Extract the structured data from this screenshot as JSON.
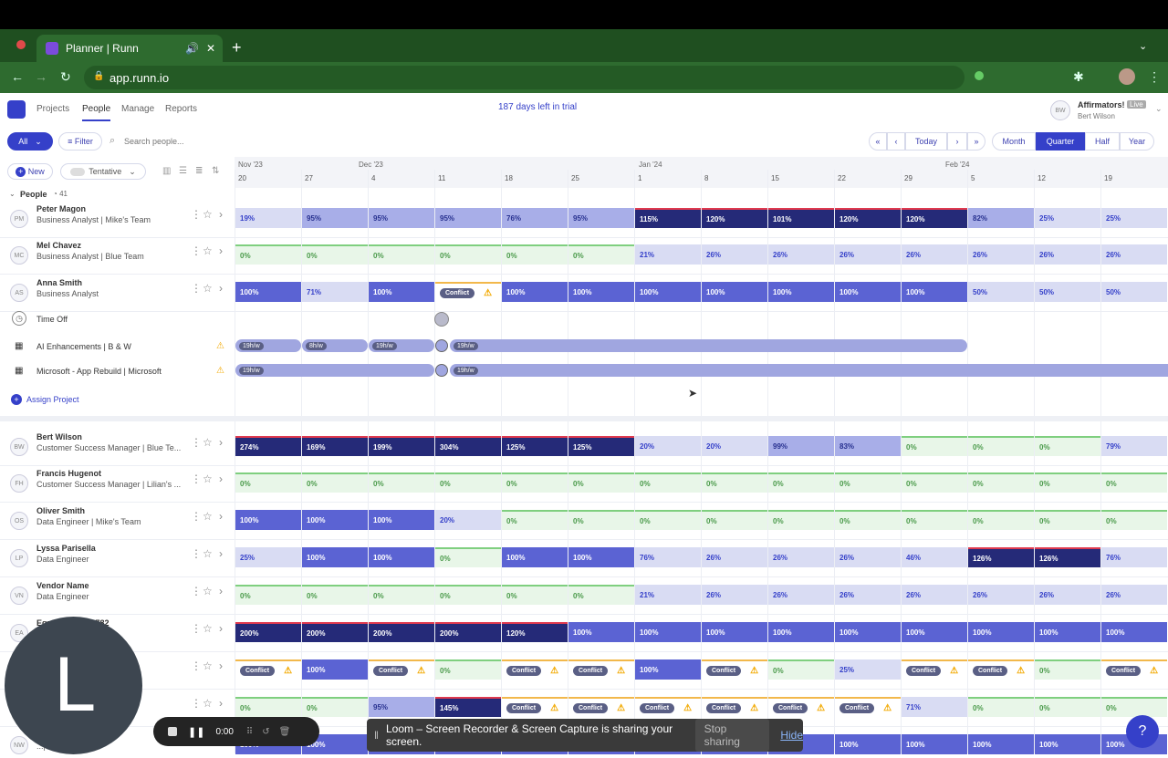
{
  "browser": {
    "tab_title": "Planner | Runn",
    "url": "app.runn.io"
  },
  "nav": {
    "projects": "Projects",
    "people": "People",
    "manage": "Manage",
    "reports": "Reports",
    "trial": "187 days left in trial"
  },
  "account": {
    "initials": "BW",
    "org": "Affirmators!",
    "badge": "Live",
    "user": "Bert Wilson"
  },
  "toolbar": {
    "all": "All",
    "filter": "Filter",
    "search_placeholder": "Search people...",
    "today": "Today",
    "new": "New",
    "tentative": "Tentative",
    "views": [
      "Month",
      "Quarter",
      "Half",
      "Year"
    ],
    "active_view": "Quarter"
  },
  "timeline": {
    "months": [
      {
        "label": "Nov '23"
      },
      {
        "label": "Dec '23"
      },
      {
        "label": "Jan '24"
      },
      {
        "label": "Feb '24"
      }
    ],
    "weeks": [
      "20",
      "27",
      "4",
      "11",
      "18",
      "25",
      "1",
      "8",
      "15",
      "22",
      "29",
      "5",
      "12",
      "19"
    ]
  },
  "group": {
    "label": "People",
    "count": "41"
  },
  "rows": [
    {
      "initials": "PM",
      "name": "Peter Magon",
      "role": "Business Analyst | Mike's Team",
      "cells": [
        "19%",
        "95%",
        "95%",
        "95%",
        "76%",
        "95%",
        "115%",
        "120%",
        "101%",
        "120%",
        "120%",
        "82%",
        "25%",
        "25%"
      ],
      "types": [
        "light",
        "mid",
        "mid",
        "mid",
        "mid",
        "mid",
        "over",
        "over",
        "over",
        "over",
        "over",
        "mid",
        "light",
        "light"
      ]
    },
    {
      "initials": "MC",
      "name": "Mel Chavez",
      "role": "Business Analyst | Blue Team",
      "cells": [
        "0%",
        "0%",
        "0%",
        "0%",
        "0%",
        "0%",
        "21%",
        "26%",
        "26%",
        "26%",
        "26%",
        "26%",
        "26%",
        "26%"
      ],
      "types": [
        "green",
        "green",
        "green",
        "green",
        "green",
        "green",
        "light",
        "light",
        "light",
        "light",
        "light",
        "light",
        "light",
        "light"
      ]
    },
    {
      "initials": "AS",
      "name": "Anna Smith",
      "role": "Business Analyst",
      "cells": [
        "100%",
        "71%",
        "100%",
        "Conflict",
        "100%",
        "100%",
        "100%",
        "100%",
        "100%",
        "100%",
        "100%",
        "50%",
        "50%",
        "50%"
      ],
      "types": [
        "full",
        "light",
        "full",
        "conf",
        "full",
        "full",
        "full",
        "full",
        "full",
        "full",
        "full",
        "light",
        "light",
        "light"
      ]
    }
  ],
  "anna_sub": {
    "time_off": "Time Off",
    "proj1": "AI Enhancements | B & W",
    "proj2": "Microsoft - App Rebuild | Microsoft",
    "assign": "Assign Project",
    "p1_bars": [
      "19h/w",
      "8h/w",
      "19h/w",
      "19h/w"
    ],
    "p2_bars": [
      "19h/w",
      "19h/w"
    ]
  },
  "rows2": [
    {
      "initials": "BW",
      "name": "Bert Wilson",
      "role": "Customer Success Manager | Blue Te...",
      "cells": [
        "274%",
        "169%",
        "199%",
        "304%",
        "125%",
        "125%",
        "20%",
        "20%",
        "99%",
        "83%",
        "0%",
        "0%",
        "0%",
        "79%"
      ],
      "types": [
        "over",
        "over",
        "over",
        "over",
        "over",
        "over",
        "light",
        "light",
        "mid",
        "mid",
        "green",
        "green",
        "green",
        "light"
      ]
    },
    {
      "initials": "FH",
      "name": "Francis Hugenot",
      "role": "Customer Success Manager | Lilian's ...",
      "cells": [
        "0%",
        "0%",
        "0%",
        "0%",
        "0%",
        "0%",
        "0%",
        "0%",
        "0%",
        "0%",
        "0%",
        "0%",
        "0%",
        "0%"
      ],
      "types": [
        "green",
        "green",
        "green",
        "green",
        "green",
        "green",
        "green",
        "green",
        "green",
        "green",
        "green",
        "green",
        "green",
        "green"
      ]
    },
    {
      "initials": "OS",
      "name": "Oliver Smith",
      "role": "Data Engineer | Mike's Team",
      "cells": [
        "100%",
        "100%",
        "100%",
        "20%",
        "0%",
        "0%",
        "0%",
        "0%",
        "0%",
        "0%",
        "0%",
        "0%",
        "0%",
        "0%"
      ],
      "types": [
        "full",
        "full",
        "full",
        "light",
        "green",
        "green",
        "green",
        "green",
        "green",
        "green",
        "green",
        "green",
        "green",
        "green"
      ]
    },
    {
      "initials": "LP",
      "name": "Lyssa Parisella",
      "role": "Data Engineer",
      "cells": [
        "25%",
        "100%",
        "100%",
        "0%",
        "100%",
        "100%",
        "76%",
        "26%",
        "26%",
        "26%",
        "46%",
        "126%",
        "126%",
        "76%"
      ],
      "types": [
        "light",
        "full",
        "full",
        "green",
        "full",
        "full",
        "light",
        "light",
        "light",
        "light",
        "light",
        "over",
        "over",
        "light"
      ]
    },
    {
      "initials": "VN",
      "name": "Vendor Name",
      "role": "Data Engineer",
      "cells": [
        "0%",
        "0%",
        "0%",
        "0%",
        "0%",
        "0%",
        "21%",
        "26%",
        "26%",
        "26%",
        "26%",
        "26%",
        "26%",
        "26%"
      ],
      "types": [
        "green",
        "green",
        "green",
        "green",
        "green",
        "green",
        "light",
        "light",
        "light",
        "light",
        "light",
        "light",
        "light",
        "light"
      ]
    },
    {
      "initials": "EA",
      "name": "Equi... Noha 61782",
      "role": "",
      "cells": [
        "200%",
        "200%",
        "200%",
        "200%",
        "120%",
        "100%",
        "100%",
        "100%",
        "100%",
        "100%",
        "100%",
        "100%",
        "100%",
        "100%"
      ],
      "types": [
        "over",
        "over",
        "over",
        "over",
        "over",
        "full",
        "full",
        "full",
        "full",
        "full",
        "full",
        "full",
        "full",
        "full"
      ]
    },
    {
      "initials": "",
      "name": "",
      "role": "...w team",
      "cells": [
        "Conflict",
        "100%",
        "Conflict",
        "0%",
        "Conflict",
        "Conflict",
        "100%",
        "Conflict",
        "0%",
        "25%",
        "Conflict",
        "Conflict",
        "0%",
        "Conflict"
      ],
      "types": [
        "conf",
        "full",
        "conf",
        "green",
        "conf",
        "conf",
        "full",
        "conf",
        "green",
        "light",
        "conf",
        "conf",
        "green",
        "conf"
      ]
    },
    {
      "initials": "",
      "name": "",
      "role": "...s Team",
      "cells": [
        "0%",
        "0%",
        "95%",
        "145%",
        "Conflict",
        "Conflict",
        "Conflict",
        "Conflict",
        "Conflict",
        "Conflict",
        "71%",
        "0%",
        "0%",
        "0%"
      ],
      "types": [
        "green",
        "green",
        "mid",
        "over",
        "conf",
        "conf",
        "conf",
        "conf",
        "conf",
        "conf",
        "light",
        "green",
        "green",
        "green"
      ]
    },
    {
      "initials": "NW",
      "name": "",
      "role": "...| Mike's Te...",
      "cells": [
        "100%",
        "100%",
        "100%",
        "100%",
        "100%",
        "100%",
        "100%",
        "100%",
        "100%",
        "100%",
        "100%",
        "100%",
        "100%",
        "100%"
      ],
      "types": [
        "full",
        "full",
        "full",
        "full",
        "full",
        "full",
        "full",
        "full",
        "full",
        "full",
        "full",
        "full",
        "full",
        "full"
      ]
    }
  ],
  "loom": {
    "initial": "L",
    "timer": "0:00",
    "message": "Loom – Screen Recorder & Screen Capture is sharing your screen.",
    "stop": "Stop sharing",
    "hide": "Hide"
  }
}
